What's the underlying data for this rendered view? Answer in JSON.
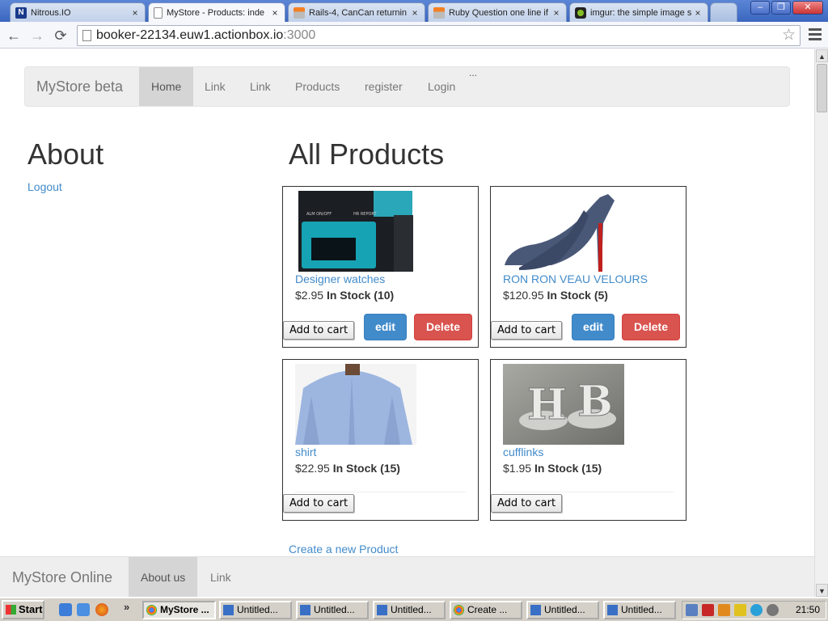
{
  "browser": {
    "tabs": [
      {
        "title": "Nitrous.IO",
        "active": false,
        "icon": "nitrous-icon"
      },
      {
        "title": "MyStore - Products: inde",
        "active": true,
        "icon": "page-icon"
      },
      {
        "title": "Rails-4, CanCan returnin",
        "active": false,
        "icon": "stackoverflow-icon"
      },
      {
        "title": "Ruby Question one line if",
        "active": false,
        "icon": "stackoverflow-icon"
      },
      {
        "title": "imgur: the simple image s",
        "active": false,
        "icon": "imgur-icon"
      }
    ],
    "close_glyph": "×",
    "url_host": "booker-22134.euw1.actionbox.io",
    "url_port": ":3000",
    "back_glyph": "←",
    "forward_glyph": "→",
    "reload_glyph": "⟳",
    "star_glyph": "☆",
    "window_controls": {
      "minimize": "–",
      "restore": "❐",
      "close": "✕"
    }
  },
  "navbar": {
    "brand": "MyStore beta",
    "links": [
      "Home",
      "Link",
      "Link",
      "Products",
      "register",
      "Login"
    ],
    "active_index": 0,
    "overflow": "..."
  },
  "sidebar": {
    "title": "About",
    "logout": "Logout"
  },
  "main": {
    "title": "All Products",
    "products": [
      {
        "name": "Designer watches",
        "price": "$2.95",
        "stock": "In Stock (10)",
        "image": "watch",
        "show_edit": true
      },
      {
        "name": "RON RON VEAU VELOURS",
        "price": "$120.95",
        "stock": "In Stock (5)",
        "image": "heels",
        "show_edit": true
      },
      {
        "name": "shirt",
        "price": "$22.95",
        "stock": "In Stock (15)",
        "image": "shirt",
        "show_edit": false
      },
      {
        "name": "cufflinks",
        "price": "$1.95",
        "stock": "In Stock (15)",
        "image": "cufflinks",
        "show_edit": false
      }
    ],
    "add_to_cart": "Add to cart",
    "edit": "edit",
    "delete": "Delete",
    "create_link": "Create a new Product"
  },
  "footer": {
    "brand": "MyStore Online",
    "links": [
      "About us",
      "Link"
    ],
    "active_index": 0
  },
  "taskbar": {
    "start": "Start",
    "more": "»",
    "items": [
      {
        "label": "MyStore ...",
        "active": true
      },
      {
        "label": "Untitled...",
        "active": false
      },
      {
        "label": "Untitled...",
        "active": false
      },
      {
        "label": "Untitled...",
        "active": false
      },
      {
        "label": "Create ...",
        "active": false
      },
      {
        "label": "Untitled...",
        "active": false
      },
      {
        "label": "Untitled...",
        "active": false
      }
    ],
    "clock": "21:50"
  },
  "colors": {
    "link": "#428bca",
    "edit_button": "#428bca",
    "delete_button": "#d9534f",
    "navbar_bg": "#eeeeee"
  }
}
